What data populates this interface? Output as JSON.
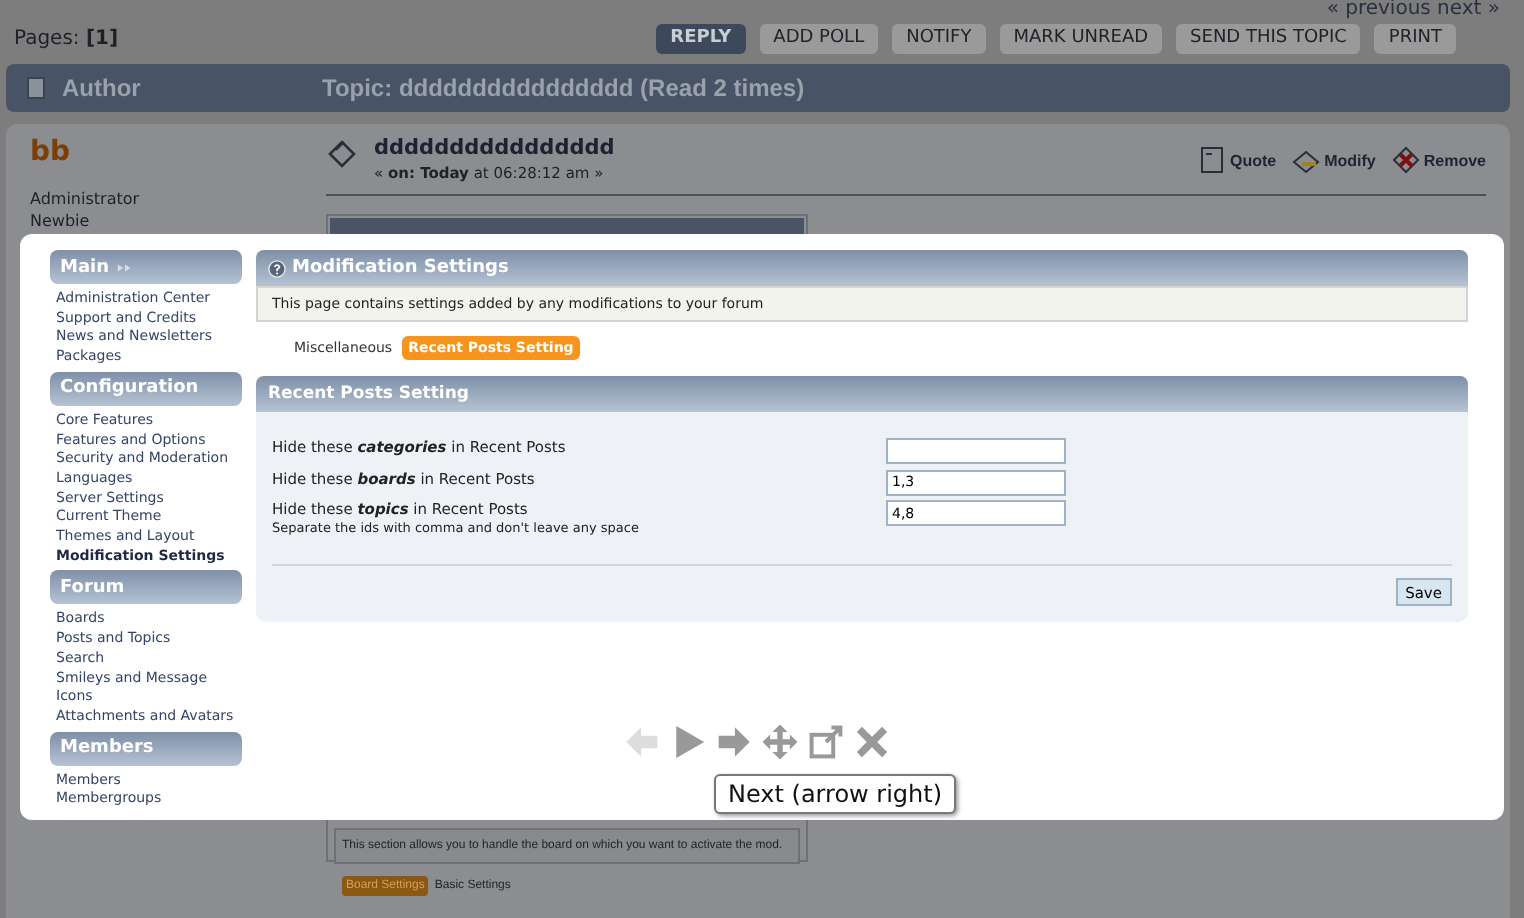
{
  "page": {
    "pagination": "« previous next »",
    "pages_label": "Pages:",
    "pages_value": "[1]",
    "buttons": [
      {
        "label": "REPLY",
        "selected": true
      },
      {
        "label": "ADD POLL",
        "selected": false
      },
      {
        "label": "NOTIFY",
        "selected": false
      },
      {
        "label": "MARK UNREAD",
        "selected": false
      },
      {
        "label": "SEND THIS TOPIC",
        "selected": false
      },
      {
        "label": "PRINT",
        "selected": false
      }
    ]
  },
  "topic_header": {
    "author_label": "Author",
    "topic": "Topic: dddddddddddddddd  (Read 2 times)"
  },
  "post": {
    "user": "bb",
    "role": "Administrator",
    "rank": "Newbie",
    "subject": "dddddddddddddddd",
    "date": "« **on: Today** at 06:28:12 am »",
    "actions": [
      {
        "kind": "quote",
        "label": "Quote"
      },
      {
        "kind": "modify",
        "label": "Modify"
      },
      {
        "kind": "remove",
        "label": "Remove"
      }
    ],
    "embedded": {
      "description": "This section allows you to handle the board on which you want to activate the mod.",
      "tabs": [
        {
          "label": "Board Settings",
          "selected": true
        },
        {
          "label": "Basic Settings",
          "selected": false
        }
      ]
    }
  },
  "lightbox": {
    "sidebar": [
      {
        "title": "Main",
        "items": [
          {
            "label": "Administration Center",
            "selected": false
          },
          {
            "label": "Support and Credits",
            "selected": false
          },
          {
            "label": "News and Newsletters",
            "selected": false
          },
          {
            "label": "Packages",
            "selected": false
          }
        ]
      },
      {
        "title": "Configuration",
        "items": [
          {
            "label": "Core Features",
            "selected": false
          },
          {
            "label": "Features and Options",
            "selected": false
          },
          {
            "label": "Security and Moderation",
            "selected": false
          },
          {
            "label": "Languages",
            "selected": false
          },
          {
            "label": "Server Settings",
            "selected": false
          },
          {
            "label": "Current Theme",
            "selected": false
          },
          {
            "label": "Themes and Layout",
            "selected": false
          },
          {
            "label": "Modification Settings",
            "selected": true
          }
        ]
      },
      {
        "title": "Forum",
        "items": [
          {
            "label": "Boards",
            "selected": false
          },
          {
            "label": "Posts and Topics",
            "selected": false
          },
          {
            "label": "Search",
            "selected": false
          },
          {
            "label": "Smileys and Message Icons",
            "selected": false
          },
          {
            "label": "Attachments and Avatars",
            "selected": false
          }
        ]
      },
      {
        "title": "Members",
        "items": [
          {
            "label": "Members",
            "selected": false
          },
          {
            "label": "Membergroups",
            "selected": false
          }
        ]
      }
    ],
    "header": "Modification Settings",
    "description": "This page contains settings added by any modifications to your forum",
    "tabs": [
      {
        "label": "Miscellaneous",
        "selected": false
      },
      {
        "label": "Recent Posts Setting",
        "selected": true
      }
    ],
    "section_title": "Recent Posts Setting",
    "fields": [
      {
        "label": "Hide these **categories** in Recent Posts"
      },
      {
        "label": "Hide these **boards** in Recent Posts",
        "value": "1,3"
      },
      {
        "label": "Hide these **topics** in Recent Posts",
        "value": "4,8",
        "hint": "Separate the ids with comma and don't leave any space"
      }
    ],
    "save": "Save",
    "controls": [
      {
        "kind": "prev",
        "disabled": true
      },
      {
        "kind": "play",
        "disabled": false
      },
      {
        "kind": "next",
        "disabled": false
      },
      {
        "kind": "move",
        "disabled": false
      },
      {
        "kind": "popout",
        "disabled": false
      },
      {
        "kind": "close",
        "disabled": false
      }
    ],
    "tooltip": "Next (arrow right)"
  }
}
